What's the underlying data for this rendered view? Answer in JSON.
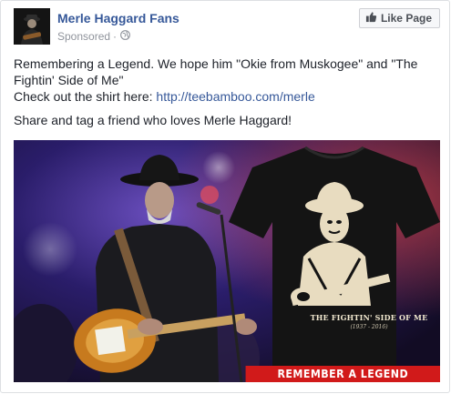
{
  "post": {
    "page_name": "Merle Haggard Fans",
    "sponsored_label": "Sponsored",
    "sponsored_separator": "·",
    "like_button_label": "Like Page",
    "text_line1": "Remembering a Legend. We hope him \"Okie from Muskogee\" and \"The Fightin' Side of Me\"",
    "text_line2_prefix": "Check out the shirt here: ",
    "text_link": "http://teebamboo.com/merle",
    "text_share": "Share and tag a friend who loves Merle Haggard!"
  },
  "image": {
    "shirt_title": "THE FIGHTIN' SIDE OF ME",
    "shirt_years": "(1937 - 2016)",
    "banner_text": "REMEMBER A LEGEND"
  },
  "colors": {
    "link": "#365899",
    "banner": "#d11a1a",
    "meta": "#90949c"
  },
  "icons": {
    "globe": "globe-icon",
    "like": "thumbs-up-icon"
  }
}
